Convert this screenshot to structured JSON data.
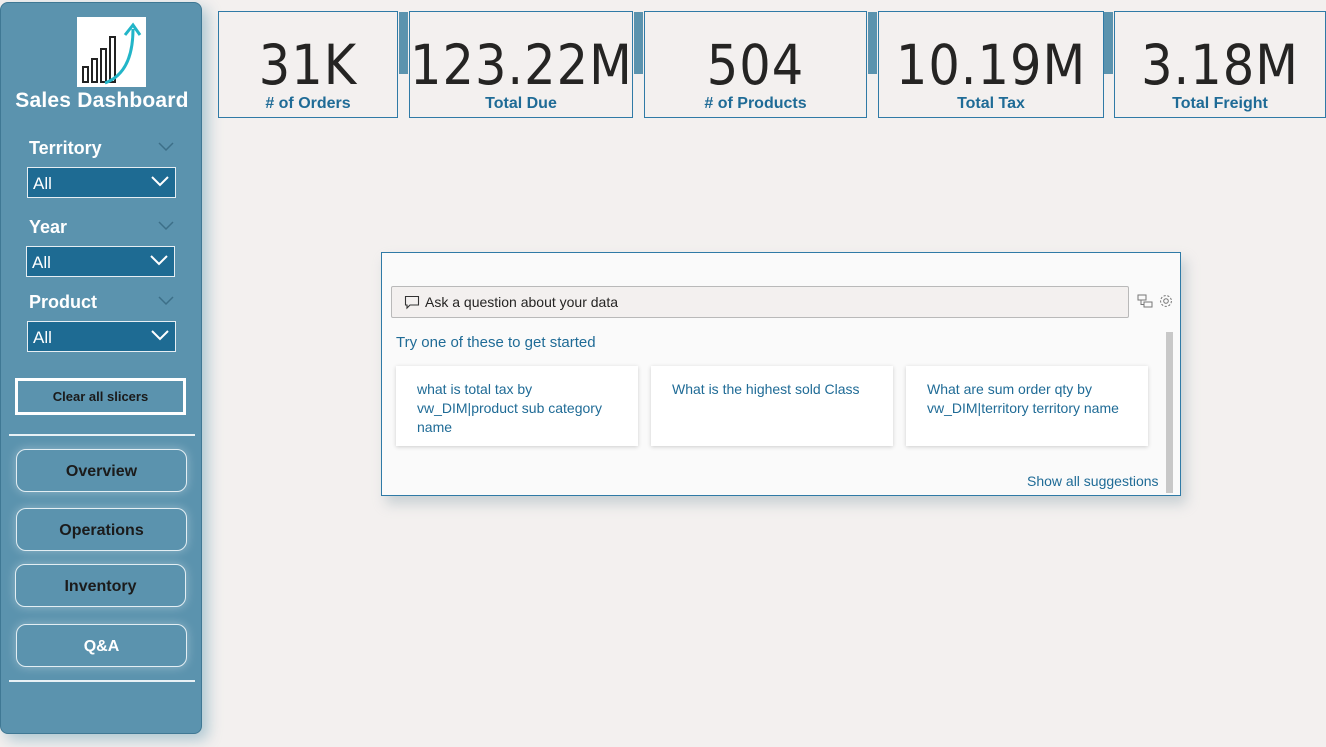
{
  "sidebar": {
    "logo_icon": "growth-chart-icon",
    "title": "Sales Dashboard",
    "slicers": [
      {
        "label": "Territory",
        "value": "All"
      },
      {
        "label": "Year",
        "value": "All"
      },
      {
        "label": "Product",
        "value": "All"
      }
    ],
    "clear_label": "Clear all slicers",
    "nav": [
      {
        "label": "Overview"
      },
      {
        "label": "Operations"
      },
      {
        "label": "Inventory"
      },
      {
        "label": "Q&A"
      }
    ]
  },
  "kpis": [
    {
      "value": "31K",
      "label": "# of Orders"
    },
    {
      "value": "123.22M",
      "label": "Total Due"
    },
    {
      "value": "504",
      "label": "# of Products"
    },
    {
      "value": "10.19M",
      "label": "Total Tax"
    },
    {
      "value": "3.18M",
      "label": "Total Freight"
    }
  ],
  "qa": {
    "placeholder": "Ask a question about your data",
    "hint": "Try one of these to get started",
    "suggestions": [
      "what is total tax by vw_DIM|product sub category name",
      "What is the highest sold Class",
      "What are sum order qty by vw_DIM|territory territory name"
    ],
    "show_all": "Show all suggestions"
  },
  "colors": {
    "sidebar": "#5b93ae",
    "slicer_box": "#1e6b93",
    "accent_text": "#1f6b96",
    "background": "#f3f0ef"
  }
}
